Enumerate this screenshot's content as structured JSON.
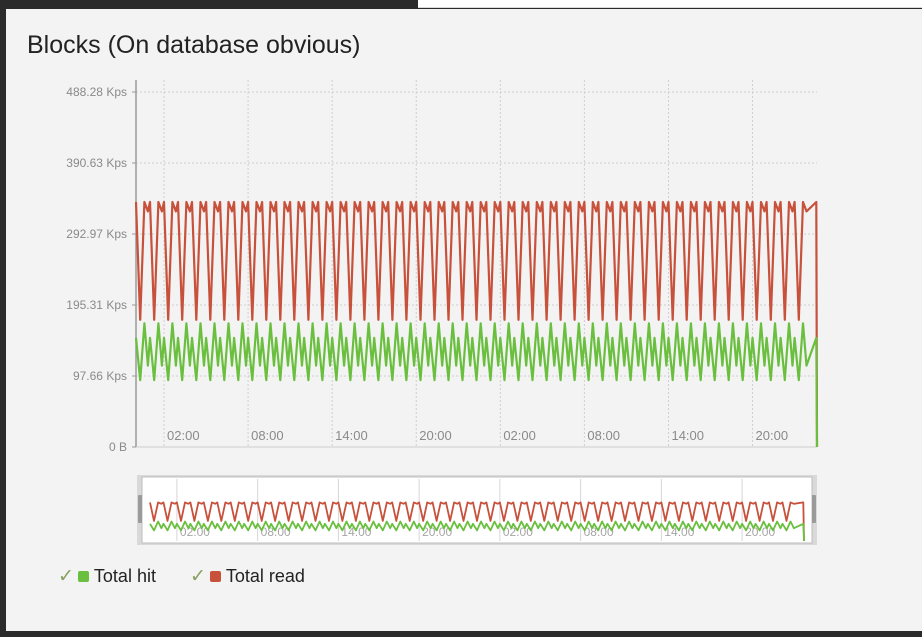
{
  "title": "Blocks (On database obvious)",
  "colors": {
    "hit": "#6abf3f",
    "read": "#c8513b",
    "grid": "#cfcfcf",
    "axis": "#9a9a9a"
  },
  "legend": [
    {
      "label": "Total hit",
      "color": "#6abf3f",
      "icon": "check-icon"
    },
    {
      "label": "Total read",
      "color": "#c8513b",
      "icon": "check-icon"
    }
  ],
  "chart_data": {
    "type": "line",
    "title": "Blocks (On database obvious)",
    "y_ticks": [
      {
        "label": "0 B",
        "value": 0
      },
      {
        "label": "97.66 Kps",
        "value": 97.66
      },
      {
        "label": "195.31 Kps",
        "value": 195.31
      },
      {
        "label": "292.97 Kps",
        "value": 292.97
      },
      {
        "label": "390.63 Kps",
        "value": 390.63
      },
      {
        "label": "488.28 Kps",
        "value": 488.28
      }
    ],
    "ylim": [
      0,
      488.28
    ],
    "x_ticks": [
      "02:00",
      "08:00",
      "14:00",
      "20:00",
      "02:00",
      "08:00",
      "14:00",
      "20:00"
    ],
    "xlim_hours": [
      0,
      48.6
    ],
    "x_tick_hours": [
      2,
      8,
      14,
      20,
      26,
      32,
      38,
      44
    ],
    "grid": true,
    "legend_position": "bottom-left",
    "series": [
      {
        "name": "Total read",
        "color": "#c8513b",
        "cycle_hours": 1.0,
        "pattern_values": [
          337,
          175,
          337,
          324
        ],
        "pattern_fraction": [
          0.0,
          0.3,
          0.6,
          0.85
        ],
        "end_value": 0
      },
      {
        "name": "Total hit",
        "color": "#6abf3f",
        "cycle_hours": 1.0,
        "pattern_values": [
          150,
          92,
          170,
          112
        ],
        "pattern_fraction": [
          0.0,
          0.3,
          0.6,
          0.85
        ],
        "end_value": 0
      }
    ],
    "navigator": {
      "x_ticks": [
        "02:00",
        "08:00",
        "14:00",
        "20:00",
        "02:00",
        "08:00",
        "14:00",
        "20:00"
      ]
    }
  }
}
